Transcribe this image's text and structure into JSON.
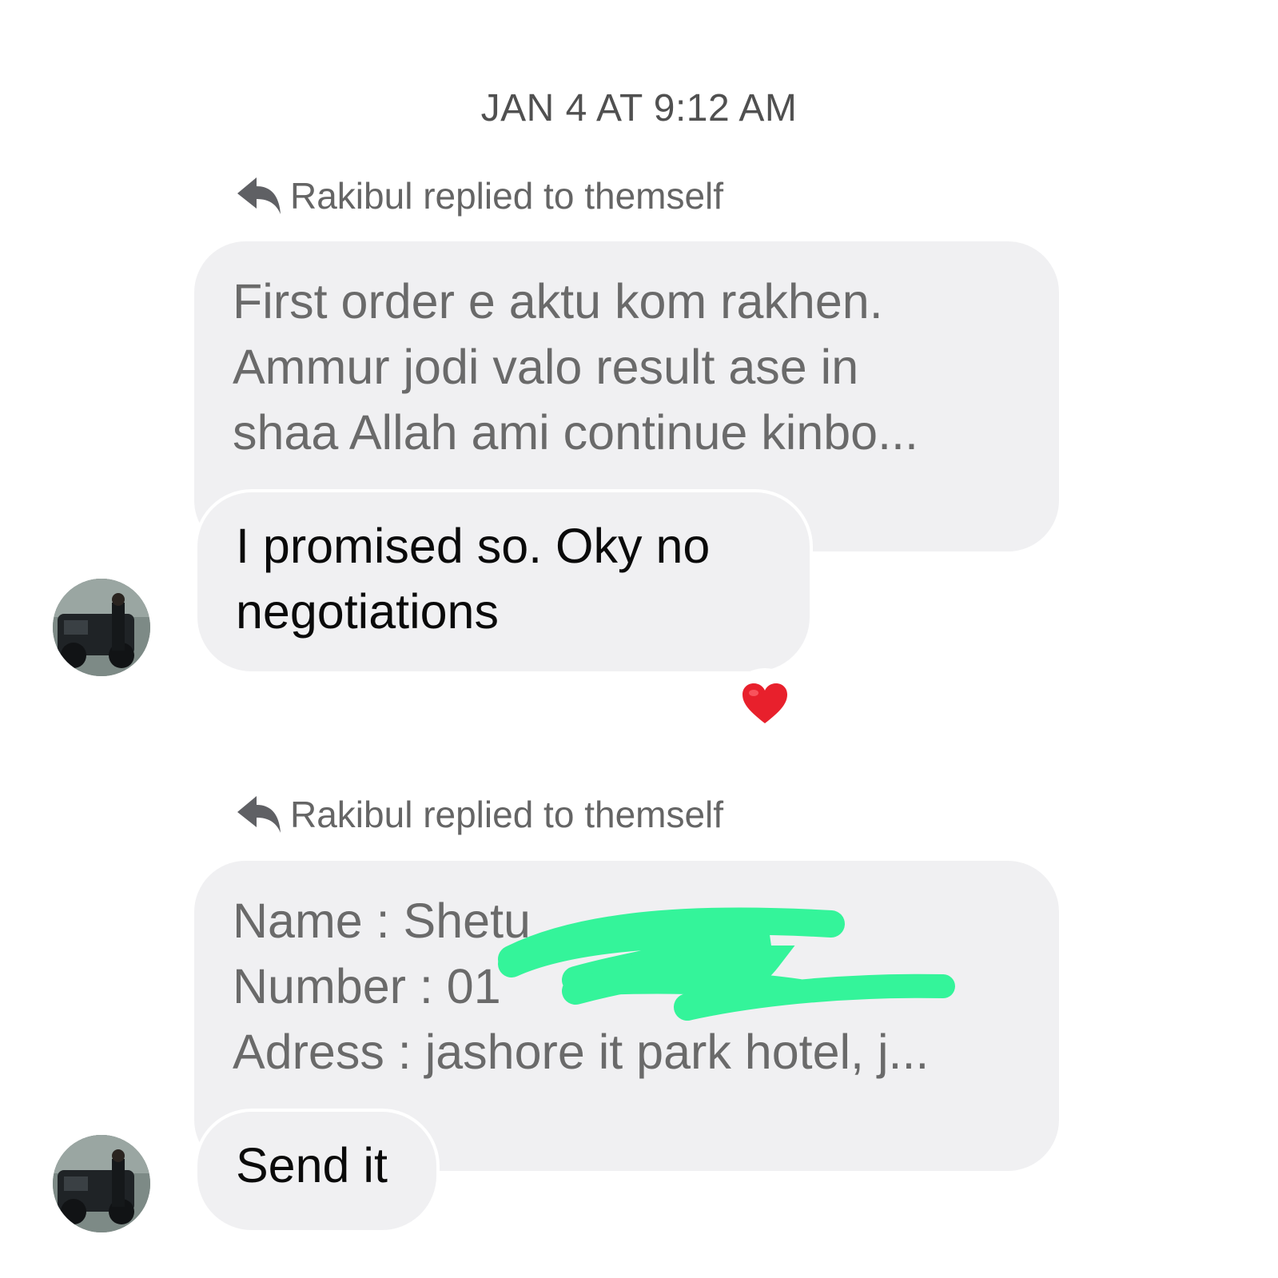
{
  "conversation": {
    "timestamp": "JAN 4 AT 9:12 AM",
    "groups": [
      {
        "reply_note": "Rakibul replied to themself",
        "quoted_lines": [
          "First order e aktu kom rakhen.",
          "Ammur jodi valo result ase in",
          "shaa Allah ami continue kinbo..."
        ],
        "message_lines": [
          "I promised so.  Oky no",
          "negotiations"
        ],
        "reaction_icon": "heart-emoji",
        "reaction_color": "#e8202c"
      },
      {
        "reply_note": "Rakibul replied to themself",
        "quoted_lines": [
          "Name : Shetu",
          "Number : 01",
          "Adress : jashore it park hotel, j..."
        ],
        "message_lines": [
          "Send it"
        ]
      }
    ]
  },
  "colors": {
    "bubble_bg": "#f0f0f2",
    "quoted_text": "#6a6a6a",
    "message_text": "#0a0a0a",
    "redaction": "#34f49a"
  }
}
